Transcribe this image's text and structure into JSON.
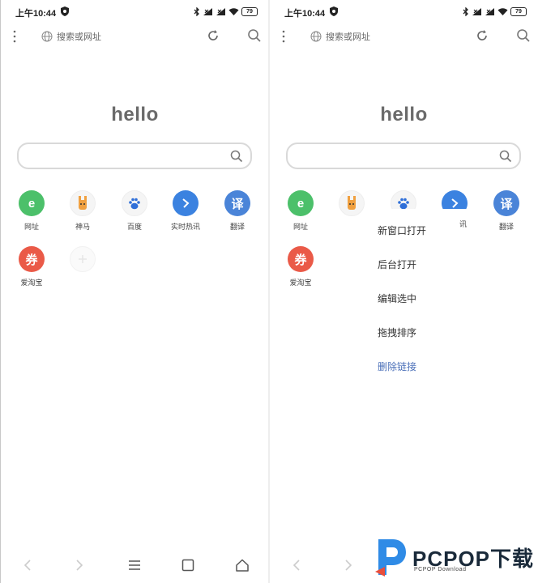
{
  "status_bar": {
    "time": "上午10:44",
    "battery": "79"
  },
  "browser": {
    "url_placeholder": "搜索或网址",
    "hello_text": "hello"
  },
  "shortcuts": [
    {
      "label": "网址",
      "glyph": "e",
      "color": "#4cc06a",
      "icon": "e-logo-icon"
    },
    {
      "label": "神马",
      "glyph": "",
      "color": "#f5f5f5",
      "icon": "alpaca-icon"
    },
    {
      "label": "百度",
      "glyph": "",
      "color": "#f5f5f5",
      "icon": "paw-icon"
    },
    {
      "label": "实时热讯",
      "glyph": "",
      "color": "#3b82e0",
      "icon": "trending-arrow-icon"
    },
    {
      "label": "翻译",
      "glyph": "译",
      "color": "#4a84d8",
      "icon": "translate-icon"
    },
    {
      "label": "爱淘宝",
      "glyph": "券",
      "color": "#ea5a48",
      "icon": "coupon-icon"
    }
  ],
  "context_menu": {
    "items": [
      "新窗口打开",
      "后台打开",
      "编辑选中",
      "拖拽排序",
      "删除链接"
    ]
  },
  "right_partial_label": "讯",
  "watermark": {
    "brand": "PCPOP下载",
    "sub": "PCPOP Download"
  },
  "colors": {
    "accent": "#4a6fb8",
    "brand_blue": "#2f8be6"
  }
}
